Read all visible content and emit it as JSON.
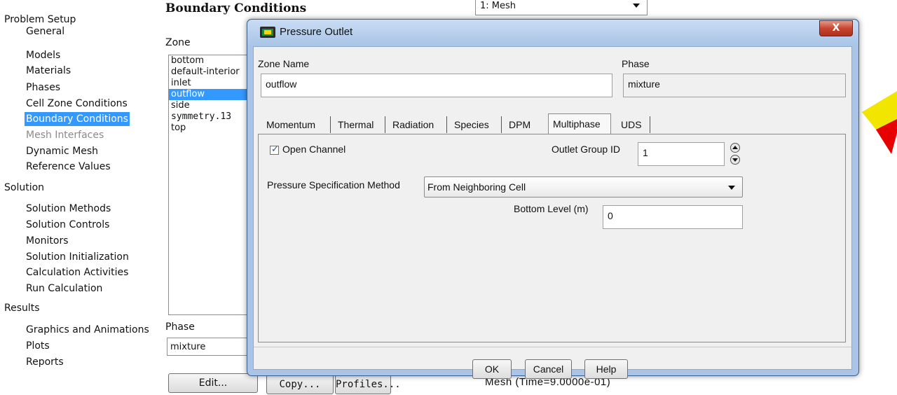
{
  "nav": {
    "problem_setup": "Problem Setup",
    "problem_items": [
      "General",
      "Models",
      "Materials",
      "Phases",
      "Cell Zone Conditions",
      "Boundary Conditions",
      "Mesh Interfaces",
      "Dynamic Mesh",
      "Reference Values"
    ],
    "solution": "Solution",
    "solution_items": [
      "Solution Methods",
      "Solution Controls",
      "Monitors",
      "Solution Initialization",
      "Calculation Activities",
      "Run Calculation"
    ],
    "results": "Results",
    "results_items": [
      "Graphics and Animations",
      "Plots",
      "Reports"
    ],
    "selected": "Boundary Conditions",
    "disabled": "Mesh Interfaces"
  },
  "bc": {
    "title": "Boundary Conditions",
    "zone_label": "Zone",
    "zones": [
      "bottom",
      "default-interior",
      "inlet",
      "outflow",
      "side",
      "symmetry.13",
      "top"
    ],
    "selected_zone": "outflow",
    "phase_label": "Phase",
    "phase_value": "mixture",
    "edit_label": "Edit...",
    "copy_label": "Copy...",
    "profiles_label": "Profiles..."
  },
  "graphics": {
    "window_combo": "1: Mesh",
    "status": "Mesh (Time=9.0000e-01)"
  },
  "dialog": {
    "title": "Pressure Outlet",
    "close_glyph": "X",
    "zone_name_label": "Zone Name",
    "zone_name_value": "outflow",
    "phase_label": "Phase",
    "phase_value": "mixture",
    "tabs": [
      "Momentum",
      "Thermal",
      "Radiation",
      "Species",
      "DPM",
      "Multiphase",
      "UDS"
    ],
    "active_tab": "Multiphase",
    "open_channel_label": "Open Channel",
    "open_channel_checked": true,
    "outlet_group_label": "Outlet Group ID",
    "outlet_group_value": "1",
    "pressure_method_label": "Pressure Specification Method",
    "pressure_method_value": "From Neighboring Cell",
    "bottom_level_label": "Bottom Level (m)",
    "bottom_level_value": "0",
    "ok_label": "OK",
    "cancel_label": "Cancel",
    "help_label": "Help"
  },
  "colors": {
    "selection": "#3399ff",
    "dialog_frame": "#a9c4e6",
    "close_button": "#c8452f",
    "geometry_yellow": "#f2e600",
    "geometry_red": "#e60000"
  }
}
